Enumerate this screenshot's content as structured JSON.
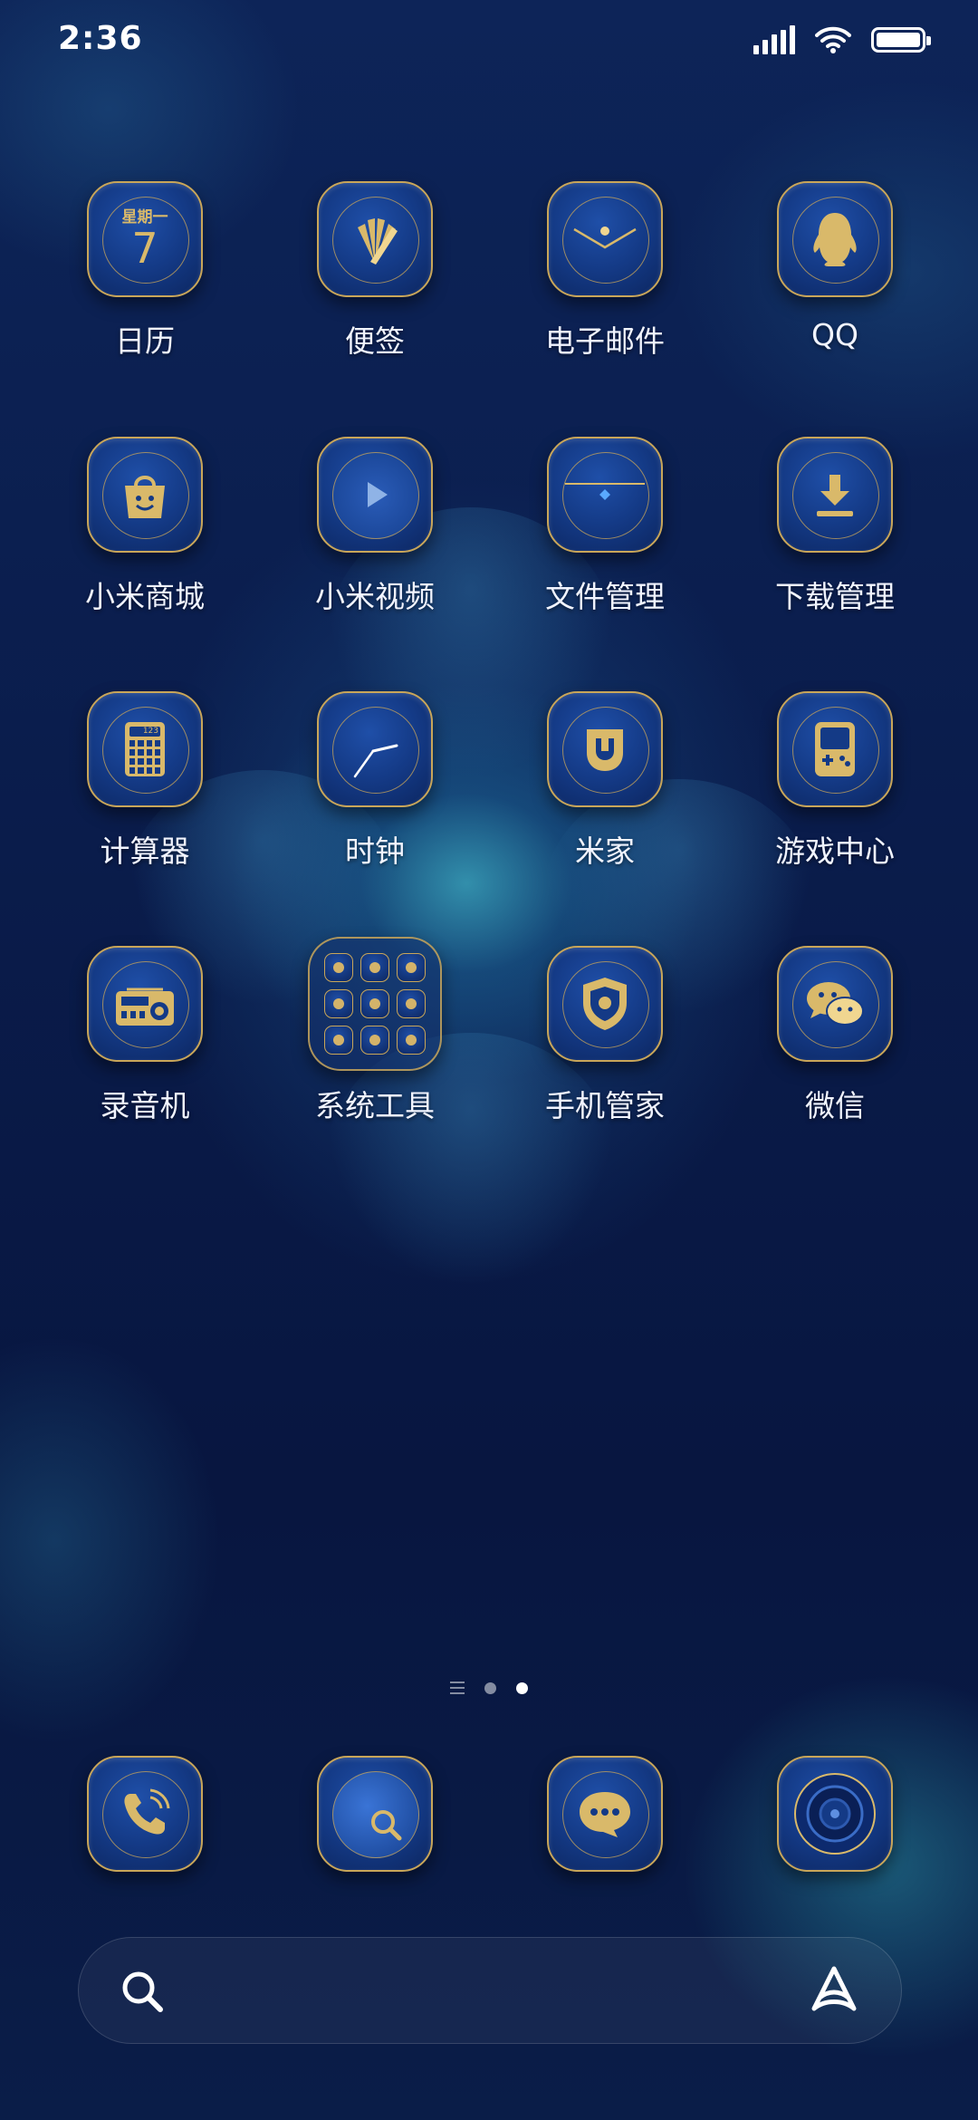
{
  "status_bar": {
    "time": "2:36",
    "signal_icon": "cellular-signal-icon",
    "wifi_icon": "wifi-icon",
    "battery_icon": "battery-icon",
    "battery_level": 1.0
  },
  "apps": [
    {
      "label": "日历",
      "icon": "calendar-icon",
      "calendar_weekday": "星期一",
      "calendar_day": "7"
    },
    {
      "label": "便签",
      "icon": "notes-icon"
    },
    {
      "label": "电子邮件",
      "icon": "email-icon"
    },
    {
      "label": "QQ",
      "icon": "qq-penguin-icon"
    },
    {
      "label": "小米商城",
      "icon": "shopping-bag-icon"
    },
    {
      "label": "小米视频",
      "icon": "play-icon"
    },
    {
      "label": "文件管理",
      "icon": "folder-icon"
    },
    {
      "label": "下载管理",
      "icon": "download-icon"
    },
    {
      "label": "计算器",
      "icon": "calculator-icon",
      "calculator_display": "123"
    },
    {
      "label": "时钟",
      "icon": "clock-icon"
    },
    {
      "label": "米家",
      "icon": "mijia-icon"
    },
    {
      "label": "游戏中心",
      "icon": "gamepad-icon"
    },
    {
      "label": "录音机",
      "icon": "radio-recorder-icon"
    },
    {
      "label": "系统工具",
      "icon": "folder-system-tools-icon"
    },
    {
      "label": "手机管家",
      "icon": "shield-icon"
    },
    {
      "label": "微信",
      "icon": "wechat-icon"
    }
  ],
  "page_indicator": {
    "pages": 3,
    "current": 3
  },
  "dock": [
    {
      "icon": "phone-icon"
    },
    {
      "icon": "browser-globe-icon"
    },
    {
      "icon": "messages-icon"
    },
    {
      "icon": "camera-icon"
    }
  ],
  "search_bar": {
    "search_icon": "search-icon",
    "assistant_icon": "assistant-icon"
  },
  "colors": {
    "gold": "#c9a659",
    "icon_blue": "#143a86",
    "background": "#0a1a45"
  }
}
